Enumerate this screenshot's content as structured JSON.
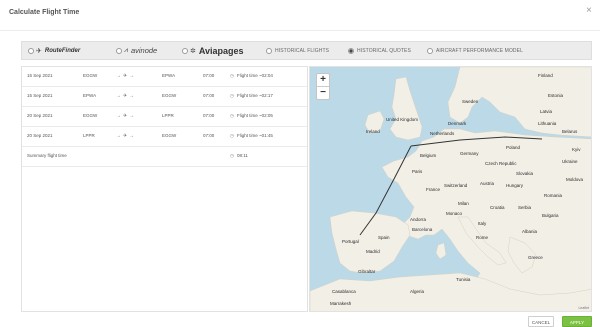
{
  "dialog": {
    "title": "Calculate Flight Time",
    "close_glyph": "×",
    "cancel_label": "CANCEL",
    "apply_label": "APPLY"
  },
  "sources": [
    {
      "name": "routefinder",
      "label": "RouteFinder",
      "icon": "plane-glyph",
      "selected": false
    },
    {
      "name": "avinode",
      "label": "avinode",
      "icon": "avinode-glyph",
      "selected": false
    },
    {
      "name": "aviapages",
      "label": "Aviapages",
      "icon": "aviapages-glyph",
      "selected": false
    },
    {
      "name": "historical-flights",
      "label": "HISTORICAL FLIGHTS",
      "selected": false
    },
    {
      "name": "historical-quotes",
      "label": "HISTORICAL QUOTES",
      "selected": true
    },
    {
      "name": "aircraft-performance-model",
      "label": "AIRCRAFT PERFORMANCE MODEL",
      "selected": false
    }
  ],
  "legs": [
    {
      "date": "15 Sep 2021",
      "from": "EGGW",
      "to": "EPWA",
      "time": "07:00",
      "flight_time": "Flight time ~02:04"
    },
    {
      "date": "15 Sep 2021",
      "from": "EPWA",
      "to": "EGGW",
      "time": "07:00",
      "flight_time": "Flight time ~02:17"
    },
    {
      "date": "20 Sep 2021",
      "from": "EGGW",
      "to": "LPPR",
      "time": "07:00",
      "flight_time": "Flight time ~02:05"
    },
    {
      "date": "20 Sep 2021",
      "from": "LPPR",
      "to": "EGGW",
      "time": "07:00",
      "flight_time": "Flight time ~01:45"
    }
  ],
  "leg_arrow": "→ ✈ →",
  "summary": {
    "label": "Summary flight time",
    "value": "08:11"
  },
  "map": {
    "zoom_in": "+",
    "zoom_out": "−",
    "attribution": "Leaflet",
    "labels": [
      "Finland",
      "Estonia",
      "Latvia",
      "Sweden",
      "Denmark",
      "Lithuania",
      "Belarus",
      "Ireland",
      "United Kingdom",
      "Netherlands",
      "Germany",
      "Poland",
      "Belgium",
      "Czech Republic",
      "Paris",
      "France",
      "Switzerland",
      "Austria",
      "Hungary",
      "Romania",
      "Italy",
      "Croatia",
      "Serbia",
      "Bulgaria",
      "Milan",
      "Monaco",
      "Andorra",
      "Barcelona",
      "Spain",
      "Portugal",
      "Madrid",
      "Rome",
      "Albania",
      "Greece",
      "Gibraltar",
      "Algeria",
      "Tunisia",
      "Casablanca",
      "Marrakesh",
      "Ukraine",
      "Kyiv",
      "Slovakia",
      "Moldova"
    ],
    "colors": {
      "sea": "#bcd9e7",
      "land": "#f2efe6",
      "route": "#333333"
    }
  }
}
